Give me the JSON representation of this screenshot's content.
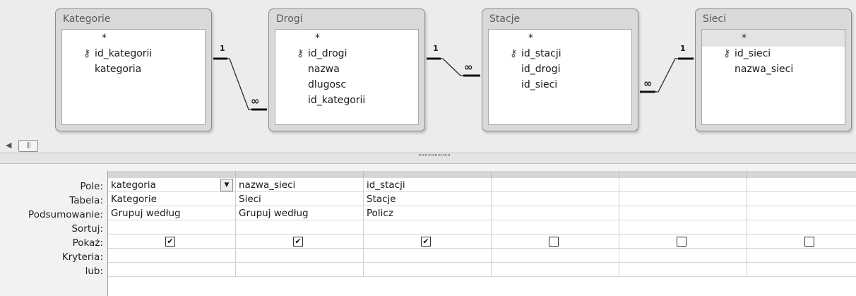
{
  "tables": [
    {
      "title": "Kategorie",
      "fields": [
        {
          "name": "*",
          "key": false
        },
        {
          "name": "id_kategorii",
          "key": true
        },
        {
          "name": "kategoria",
          "key": false
        }
      ]
    },
    {
      "title": "Drogi",
      "fields": [
        {
          "name": "*",
          "key": false
        },
        {
          "name": "id_drogi",
          "key": true
        },
        {
          "name": "nazwa",
          "key": false
        },
        {
          "name": "dlugosc",
          "key": false
        },
        {
          "name": "id_kategorii",
          "key": false
        }
      ]
    },
    {
      "title": "Stacje",
      "fields": [
        {
          "name": "*",
          "key": false
        },
        {
          "name": "id_stacji",
          "key": true
        },
        {
          "name": "id_drogi",
          "key": false
        },
        {
          "name": "id_sieci",
          "key": false
        }
      ]
    },
    {
      "title": "Sieci",
      "fields": [
        {
          "name": "*",
          "key": false
        },
        {
          "name": "id_sieci",
          "key": true
        },
        {
          "name": "nazwa_sieci",
          "key": false
        }
      ]
    }
  ],
  "relationships": {
    "one": "1",
    "many": "∞"
  },
  "grid": {
    "row_labels": [
      "Pole:",
      "Tabela:",
      "Podsumowanie:",
      "Sortuj:",
      "Pokaż:",
      "Kryteria:",
      "lub:"
    ],
    "columns": [
      {
        "field": "kategoria",
        "table": "Kategorie",
        "total": "Grupuj według",
        "show": true
      },
      {
        "field": "nazwa_sieci",
        "table": "Sieci",
        "total": "Grupuj według",
        "show": true
      },
      {
        "field": "id_stacji",
        "table": "Stacje",
        "total": "Policz",
        "show": true
      },
      {
        "field": "",
        "table": "",
        "total": "",
        "show": false
      },
      {
        "field": "",
        "table": "",
        "total": "",
        "show": false
      },
      {
        "field": "",
        "table": "",
        "total": "",
        "show": false
      }
    ]
  },
  "icons": {
    "key": "key-icon",
    "dropdown": "chevron-down-icon",
    "scroll_left": "arrow-left-icon"
  }
}
